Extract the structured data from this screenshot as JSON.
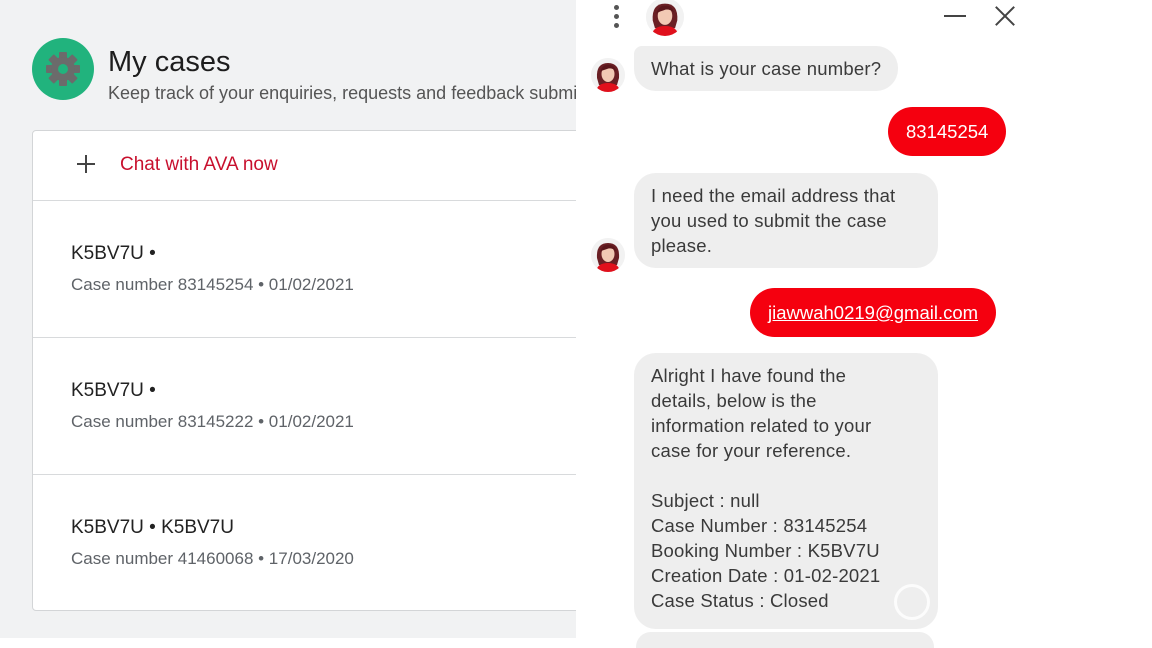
{
  "page": {
    "title": "My cases",
    "subtitle": "Keep track of your enquiries, requests and feedback submitted"
  },
  "cases": {
    "chat_label": "Chat with AVA now",
    "items": [
      {
        "title": "K5BV7U •",
        "meta": "Case number 83145254 • 01/02/2021"
      },
      {
        "title": "K5BV7U •",
        "meta": "Case number 83145222 • 01/02/2021"
      },
      {
        "title": "K5BV7U • K5BV7U",
        "meta": "Case number 41460068 • 17/03/2020"
      }
    ]
  },
  "chat": {
    "messages": {
      "q_case_number": "What is your case number?",
      "a_case_number": "83145254",
      "q_email": [
        "I need the email address that",
        "you used to submit the case",
        "please."
      ],
      "a_email": "jiawwah0219@gmail.com",
      "details": [
        "Alright I have found the",
        "details, below is the",
        "information related to your",
        "case for your reference.",
        "",
        "Subject : null",
        "Case Number : 83145254",
        "Booking Number : K5BV7U",
        "Creation Date : 01-02-2021",
        "Case Status : Closed"
      ]
    }
  },
  "colors": {
    "brand_red": "#f5000f",
    "link_red": "#c8102e",
    "logo_green": "#21b37d",
    "bot_bubble": "#eeeeee"
  },
  "icons": [
    "gear-icon",
    "plus-icon",
    "kebab-menu-icon",
    "minimize-icon",
    "close-icon",
    "ava-avatar"
  ]
}
